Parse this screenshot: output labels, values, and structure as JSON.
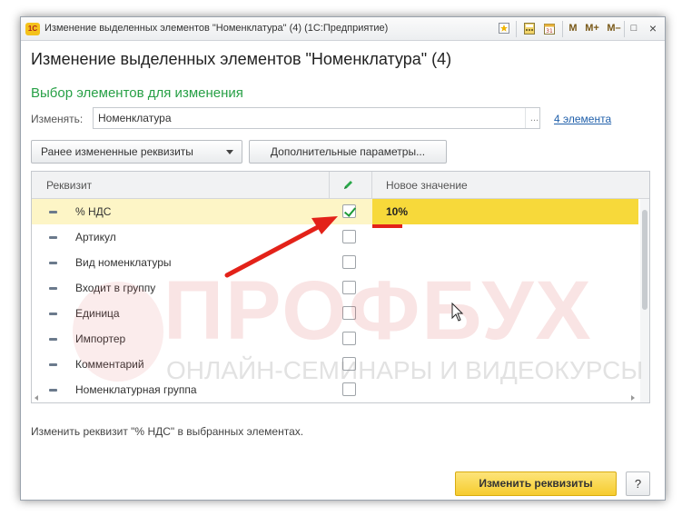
{
  "window": {
    "title": "Изменение выделенных элементов \"Номенклатура\" (4)  (1С:Предприятие)",
    "app_icon_text": "1С",
    "controls": {
      "m": "M",
      "m_plus": "M+",
      "m_minus": "M–",
      "minimize": "–",
      "maximize": "□",
      "close": "×"
    }
  },
  "dialog": {
    "title": "Изменение выделенных элементов \"Номенклатура\" (4)",
    "section_title": "Выбор элементов для изменения"
  },
  "change_field": {
    "label": "Изменять:",
    "value": "Номенклатура",
    "dots": "...",
    "elements_link": "4 элемента"
  },
  "buttons": {
    "previous_changed": "Ранее измененные реквизиты",
    "extra_params": "Дополнительные параметры...",
    "apply": "Изменить реквизиты",
    "help": "?"
  },
  "table": {
    "columns": {
      "attribute": "Реквизит",
      "new_value": "Новое значение"
    },
    "rows": [
      {
        "label": "% НДС",
        "checked": true,
        "value": "10%",
        "selected": true
      },
      {
        "label": "Артикул",
        "checked": false,
        "value": "",
        "selected": false
      },
      {
        "label": "Вид номенклатуры",
        "checked": false,
        "value": "",
        "selected": false
      },
      {
        "label": "Входит в группу",
        "checked": false,
        "value": "",
        "selected": false
      },
      {
        "label": "Единица",
        "checked": false,
        "value": "",
        "selected": false
      },
      {
        "label": "Импортер",
        "checked": false,
        "value": "",
        "selected": false
      },
      {
        "label": "Комментарий",
        "checked": false,
        "value": "",
        "selected": false
      },
      {
        "label": "Номенклатурная группа",
        "checked": false,
        "value": "",
        "selected": false
      }
    ]
  },
  "status": "Изменить реквизит \"% НДС\" в выбранных элементах.",
  "watermark": {
    "big": "ПРОФБУХ",
    "small": "ОНЛАЙН-СЕМИНАРЫ И ВИДЕОКУРСЫ"
  },
  "colors": {
    "accent_green": "#27a046",
    "selection": "#f7d93a",
    "annotation_red": "#e32219",
    "link": "#1f5faa"
  }
}
